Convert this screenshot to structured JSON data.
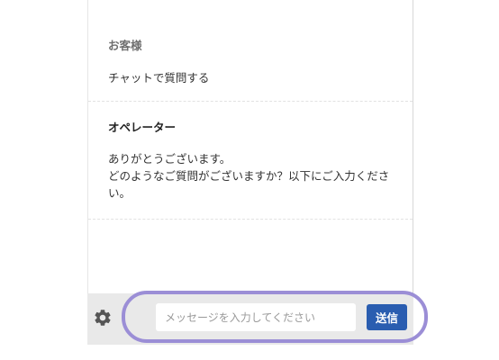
{
  "messages": [
    {
      "sender": "お客様",
      "lines": [
        "チャットで質問する"
      ]
    },
    {
      "sender": "オペレーター",
      "lines": [
        "ありがとうございます。",
        "どのようなご質問がございますか？以下にご入力くださ",
        "い。"
      ]
    }
  ],
  "composer": {
    "placeholder": "メッセージを入力してください",
    "value": "",
    "send_label": "送信"
  },
  "icons": {
    "settings": "gear-icon"
  },
  "colors": {
    "send_button": "#2a5db0",
    "footer_bg": "#e9e9e9",
    "highlight_ring": "#9b8ed6"
  }
}
